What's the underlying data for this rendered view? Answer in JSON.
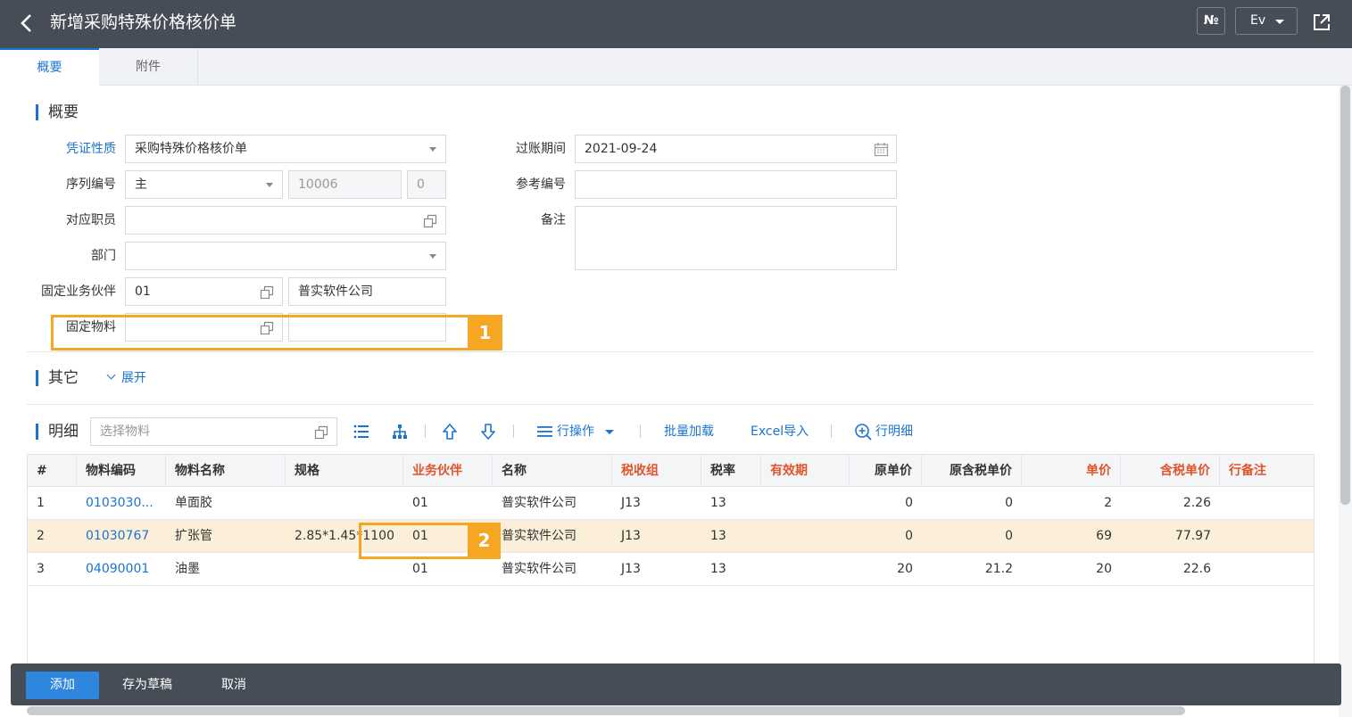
{
  "header": {
    "title": "新增采购特殊价格核价单",
    "no_label": "№",
    "ev_label": "Ev"
  },
  "tabs": [
    "概要",
    "附件"
  ],
  "summary": {
    "section_title": "概要",
    "voucher_type_label": "凭证性质",
    "voucher_type_value": "采购特殊价格核价单",
    "serial_label": "序列编号",
    "serial_main": "主",
    "serial_number": "10006",
    "serial_suffix": "0",
    "employee_label": "对应职员",
    "department_label": "部门",
    "partner_label": "固定业务伙伴",
    "partner_code": "01",
    "partner_name": "普实软件公司",
    "material_label": "固定物料",
    "posting_label": "过账期间",
    "posting_value": "2021-09-24",
    "reference_label": "参考编号",
    "remark_label": "备注"
  },
  "other": {
    "section_title": "其它",
    "expand_label": "展开"
  },
  "detail": {
    "section_title": "明细",
    "search_placeholder": "选择物料",
    "row_ops_label": "行操作",
    "batch_load_label": "批量加载",
    "excel_import_label": "Excel导入",
    "row_detail_label": "行明细",
    "columns": [
      "#",
      "物料编码",
      "物料名称",
      "规格",
      "业务伙伴",
      "名称",
      "税收组",
      "税率",
      "有效期",
      "原单价",
      "原含税单价",
      "单价",
      "含税单价",
      "行备注"
    ],
    "rows": [
      {
        "no": "1",
        "code": "0103030...",
        "name": "单面胶",
        "spec": "",
        "partner": "01",
        "partner_name": "普实软件公司",
        "tax_group": "J13",
        "tax_rate": "13",
        "validity": "",
        "orig_price": "0",
        "orig_tax_price": "0",
        "price": "2",
        "tax_price": "2.26",
        "remark": ""
      },
      {
        "no": "2",
        "code": "01030767",
        "name": "扩张管",
        "spec": "2.85*1.45*1100",
        "partner": "01",
        "partner_name": "普实软件公司",
        "tax_group": "J13",
        "tax_rate": "13",
        "validity": "",
        "orig_price": "0",
        "orig_tax_price": "0",
        "price": "69",
        "tax_price": "77.97",
        "remark": ""
      },
      {
        "no": "3",
        "code": "04090001",
        "name": "油墨",
        "spec": "",
        "partner": "01",
        "partner_name": "普实软件公司",
        "tax_group": "J13",
        "tax_rate": "13",
        "validity": "",
        "orig_price": "20",
        "orig_tax_price": "21.2",
        "price": "20",
        "tax_price": "22.6",
        "remark": ""
      }
    ]
  },
  "annotations": {
    "badge1": "1",
    "badge2": "2"
  },
  "footer": {
    "add_label": "添加",
    "draft_label": "存为草稿",
    "cancel_label": "取消"
  },
  "colors": {
    "accent": "#1b73d0",
    "header_bg": "#474d56",
    "highlight": "#f5a623",
    "required_red": "#e0552b",
    "selected_row": "#fcefd9"
  }
}
